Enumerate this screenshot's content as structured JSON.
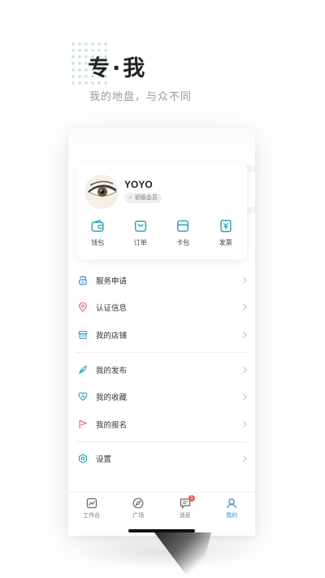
{
  "hero": {
    "title": "专·我",
    "subtitle": "我的地盘，与众不同"
  },
  "profile": {
    "username": "YOYO",
    "badge_check": "✓",
    "badge_label": "初级会员"
  },
  "quick_actions": [
    {
      "label": "钱包",
      "icon": "wallet-icon"
    },
    {
      "label": "订单",
      "icon": "order-bag-icon"
    },
    {
      "label": "卡包",
      "icon": "card-icon"
    },
    {
      "label": "发票",
      "icon": "invoice-icon"
    }
  ],
  "menu": {
    "group1": [
      {
        "label": "服务申请",
        "icon": "service-icon"
      },
      {
        "label": "认证信息",
        "icon": "location-pin-icon"
      },
      {
        "label": "我的店铺",
        "icon": "store-icon"
      }
    ],
    "group2": [
      {
        "label": "我的发布",
        "icon": "feather-icon"
      },
      {
        "label": "我的收藏",
        "icon": "heart-icon"
      },
      {
        "label": "我的报名",
        "icon": "flag-icon"
      }
    ],
    "group3": [
      {
        "label": "设置",
        "icon": "settings-icon"
      }
    ]
  },
  "tabbar": {
    "tabs": [
      {
        "label": "工作台",
        "icon": "chart-icon"
      },
      {
        "label": "广场",
        "icon": "compass-icon"
      },
      {
        "label": "消息",
        "icon": "message-icon",
        "badge": "1"
      },
      {
        "label": "我的",
        "icon": "user-icon",
        "active": true
      }
    ]
  },
  "colors": {
    "accent": "#3d8dd9",
    "teal": "#2f9fb5",
    "pink": "#e46a7a",
    "badge_red": "#ef5a5a",
    "dot_grid": "#bfe3df"
  }
}
